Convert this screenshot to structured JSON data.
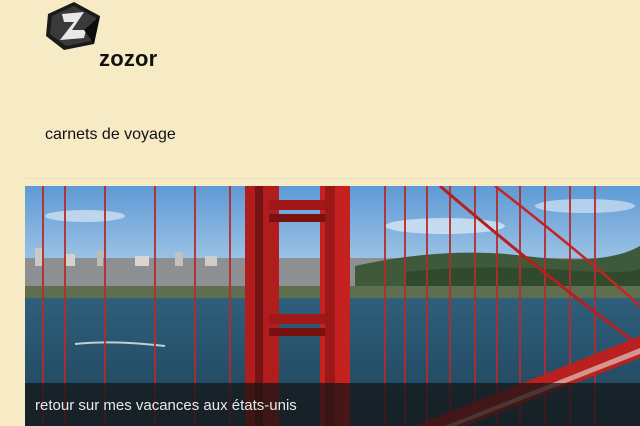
{
  "header": {
    "logo_icon": "zozor-logo-icon",
    "site_name": "zozor",
    "tagline": "carnets de voyage"
  },
  "banner": {
    "image": "golden-gate-bridge-photo",
    "caption": "retour sur mes vacances aux états-unis"
  }
}
